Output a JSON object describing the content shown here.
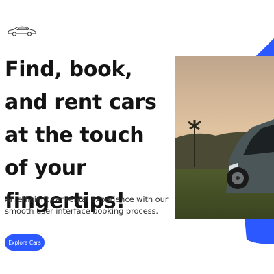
{
  "brand": {
    "logo_icon": "car-outline-icon"
  },
  "hero": {
    "headline": "Find, book, and rent cars at the touch of your fingertips!",
    "subtitle": "An efficient car rental experience with our smooth user interface booking process.",
    "cta_label": "Explore Cars",
    "image_icon": "suv-photo"
  },
  "colors": {
    "accent": "#2b59ff",
    "text": "#141414",
    "subtext": "#333333",
    "background": "#ffffff"
  }
}
